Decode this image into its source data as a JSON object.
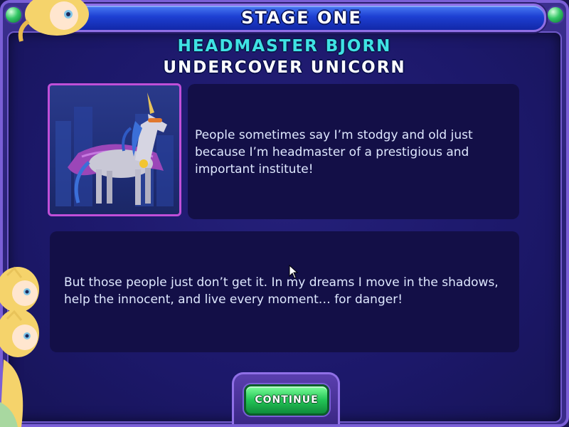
{
  "header": {
    "title": "Stage One"
  },
  "character": {
    "name": "Headmaster Bjorn",
    "alias": "Undercover Unicorn",
    "portrait_icon": "unicorn-portrait"
  },
  "dialogue": {
    "line1": "People sometimes say I’m stodgy and old just because I’m headmaster of a prestigious and important institute!",
    "line2": "But those people just don’t get it. In my dreams I move in the shadows, help the innocent, and live every moment… for danger!"
  },
  "buttons": {
    "continue_label": "CONTINUE"
  },
  "side_avatars": [
    "star-butterfly-avatar",
    "star-butterfly-avatar",
    "star-butterfly-avatar"
  ],
  "colors": {
    "accent_cyan": "#3fe3e3",
    "title_blue": "#1d3fd2",
    "continue_green": "#23c456",
    "frame_purple": "#7a5fd6"
  }
}
